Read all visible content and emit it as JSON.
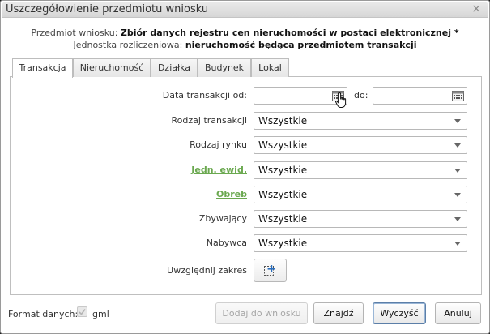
{
  "dialog": {
    "title": "Uszczegółowienie przedmiotu wniosku",
    "close_glyph": "×"
  },
  "info": {
    "subject_label": "Przedmiot wniosku:",
    "subject_value": "Zbiór danych rejestru cen nieruchomości w postaci elektronicznej *",
    "unit_label": "Jednostka rozliczeniowa:",
    "unit_value": "nieruchomość będąca przedmiotem transakcji"
  },
  "tabs": [
    {
      "label": "Transakcja",
      "active": true
    },
    {
      "label": "Nieruchomość",
      "active": false
    },
    {
      "label": "Działka",
      "active": false
    },
    {
      "label": "Budynek",
      "active": false
    },
    {
      "label": "Lokal",
      "active": false
    }
  ],
  "form": {
    "date_from_label": "Data transakcji od:",
    "date_from_value": "",
    "date_to_label": "do:",
    "date_to_value": "",
    "rows": [
      {
        "label": "Rodzaj transakcji",
        "value": "Wszystkie",
        "link": false
      },
      {
        "label": "Rodzaj rynku",
        "value": "Wszystkie",
        "link": false
      },
      {
        "label": "Jedn. ewid.",
        "value": "Wszystkie",
        "link": true
      },
      {
        "label": "Obreb",
        "value": "Wszystkie",
        "link": true
      },
      {
        "label": "Zbywający",
        "value": "Wszystkie",
        "link": false
      },
      {
        "label": "Nabywca",
        "value": "Wszystkie",
        "link": false
      }
    ],
    "range_label": "Uwzględnij zakres"
  },
  "footer": {
    "format_label": "Format danych:",
    "format_value": "gml",
    "format_checked": true,
    "buttons": {
      "add": "Dodaj do wniosku",
      "find": "Znajdź",
      "search": "Wyczyść",
      "cancel": "Anuluj"
    }
  },
  "colors": {
    "link_green": "#6aa84f",
    "primary_border": "#5c7fa8"
  },
  "icons": {
    "calendar": "calendar-icon",
    "range": "range-select-icon",
    "close": "close-icon",
    "dropdown": "chevron-down-icon",
    "cursor": "hand-cursor-icon"
  }
}
